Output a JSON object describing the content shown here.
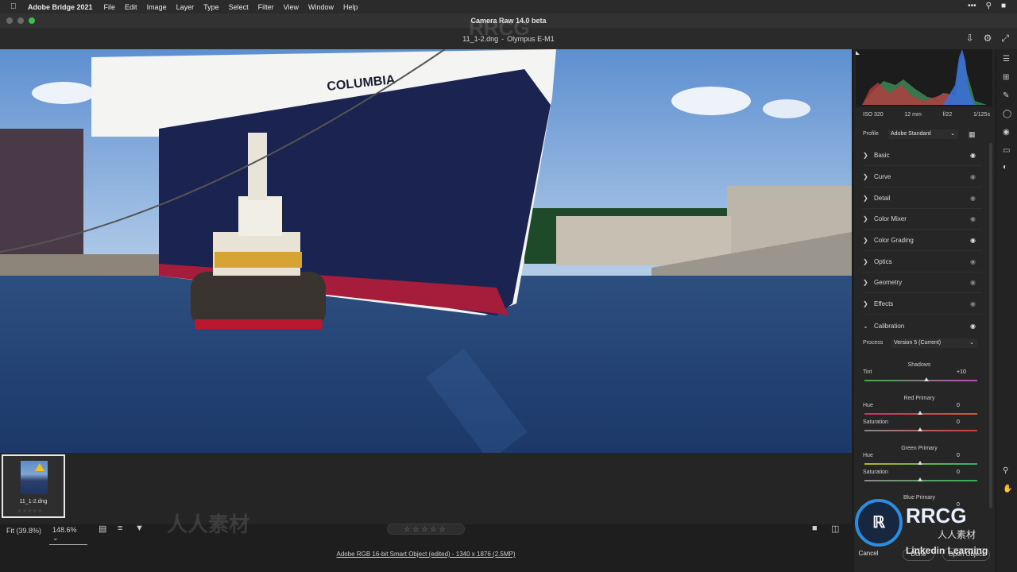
{
  "menubar": {
    "apple": "",
    "app": "Adobe Bridge 2021",
    "items": [
      "File",
      "Edit",
      "Image",
      "Layer",
      "Type",
      "Select",
      "Filter",
      "View",
      "Window",
      "Help"
    ]
  },
  "window": {
    "title": "Camera Raw 14.0 beta"
  },
  "document": {
    "name": "11_1-2.dng",
    "separator": "-",
    "camera": "Olympus E-M1"
  },
  "photo": {
    "ship_name": "COLUMBIA"
  },
  "histogram": {
    "iso": "ISO 320",
    "focal": "12 mm",
    "aperture": "f/22",
    "shutter": "1/125s"
  },
  "profile": {
    "label": "Profile",
    "value": "Adobe Standard"
  },
  "sections": [
    {
      "label": "Basic",
      "eye": "on"
    },
    {
      "label": "Curve",
      "eye": "off"
    },
    {
      "label": "Detail",
      "eye": "off"
    },
    {
      "label": "Color Mixer",
      "eye": "off"
    },
    {
      "label": "Color Grading",
      "eye": "on"
    },
    {
      "label": "Optics",
      "eye": "off"
    },
    {
      "label": "Geometry",
      "eye": "off"
    },
    {
      "label": "Effects",
      "eye": "off"
    },
    {
      "label": "Calibration",
      "eye": "on"
    }
  ],
  "calibration": {
    "process_label": "Process",
    "process_value": "Version 5 (Current)",
    "shadows_title": "Shadows",
    "tint_label": "Tint",
    "tint_value": "+10",
    "red_title": "Red Primary",
    "red_hue_label": "Hue",
    "red_hue_value": "0",
    "red_sat_label": "Saturation",
    "red_sat_value": "0",
    "green_title": "Green Primary",
    "green_hue_label": "Hue",
    "green_hue_value": "0",
    "green_sat_label": "Saturation",
    "green_sat_value": "0",
    "blue_title": "Blue Primary",
    "blue_hue_value": "0"
  },
  "filmstrip": {
    "thumb_name": "11_1-2.dng"
  },
  "bottom": {
    "fit": "Fit (39.8%)",
    "zoom": "148.6%",
    "rating": "☆☆☆☆☆",
    "footer_link": "Adobe RGB 16-bit Smart Object (edited) - 1340 x 1876 (2.5MP)",
    "cancel": "Cancel",
    "done": "Done",
    "open": "Open Object"
  },
  "watermark": {
    "brand": "RRCG",
    "cn": "人人素材",
    "sub": "Linkedin Learning"
  },
  "colors": {
    "accent": "#2a8ddf",
    "sky": "#7aa8d8",
    "hull": "#1a2247",
    "water": "#1f3f6e"
  }
}
